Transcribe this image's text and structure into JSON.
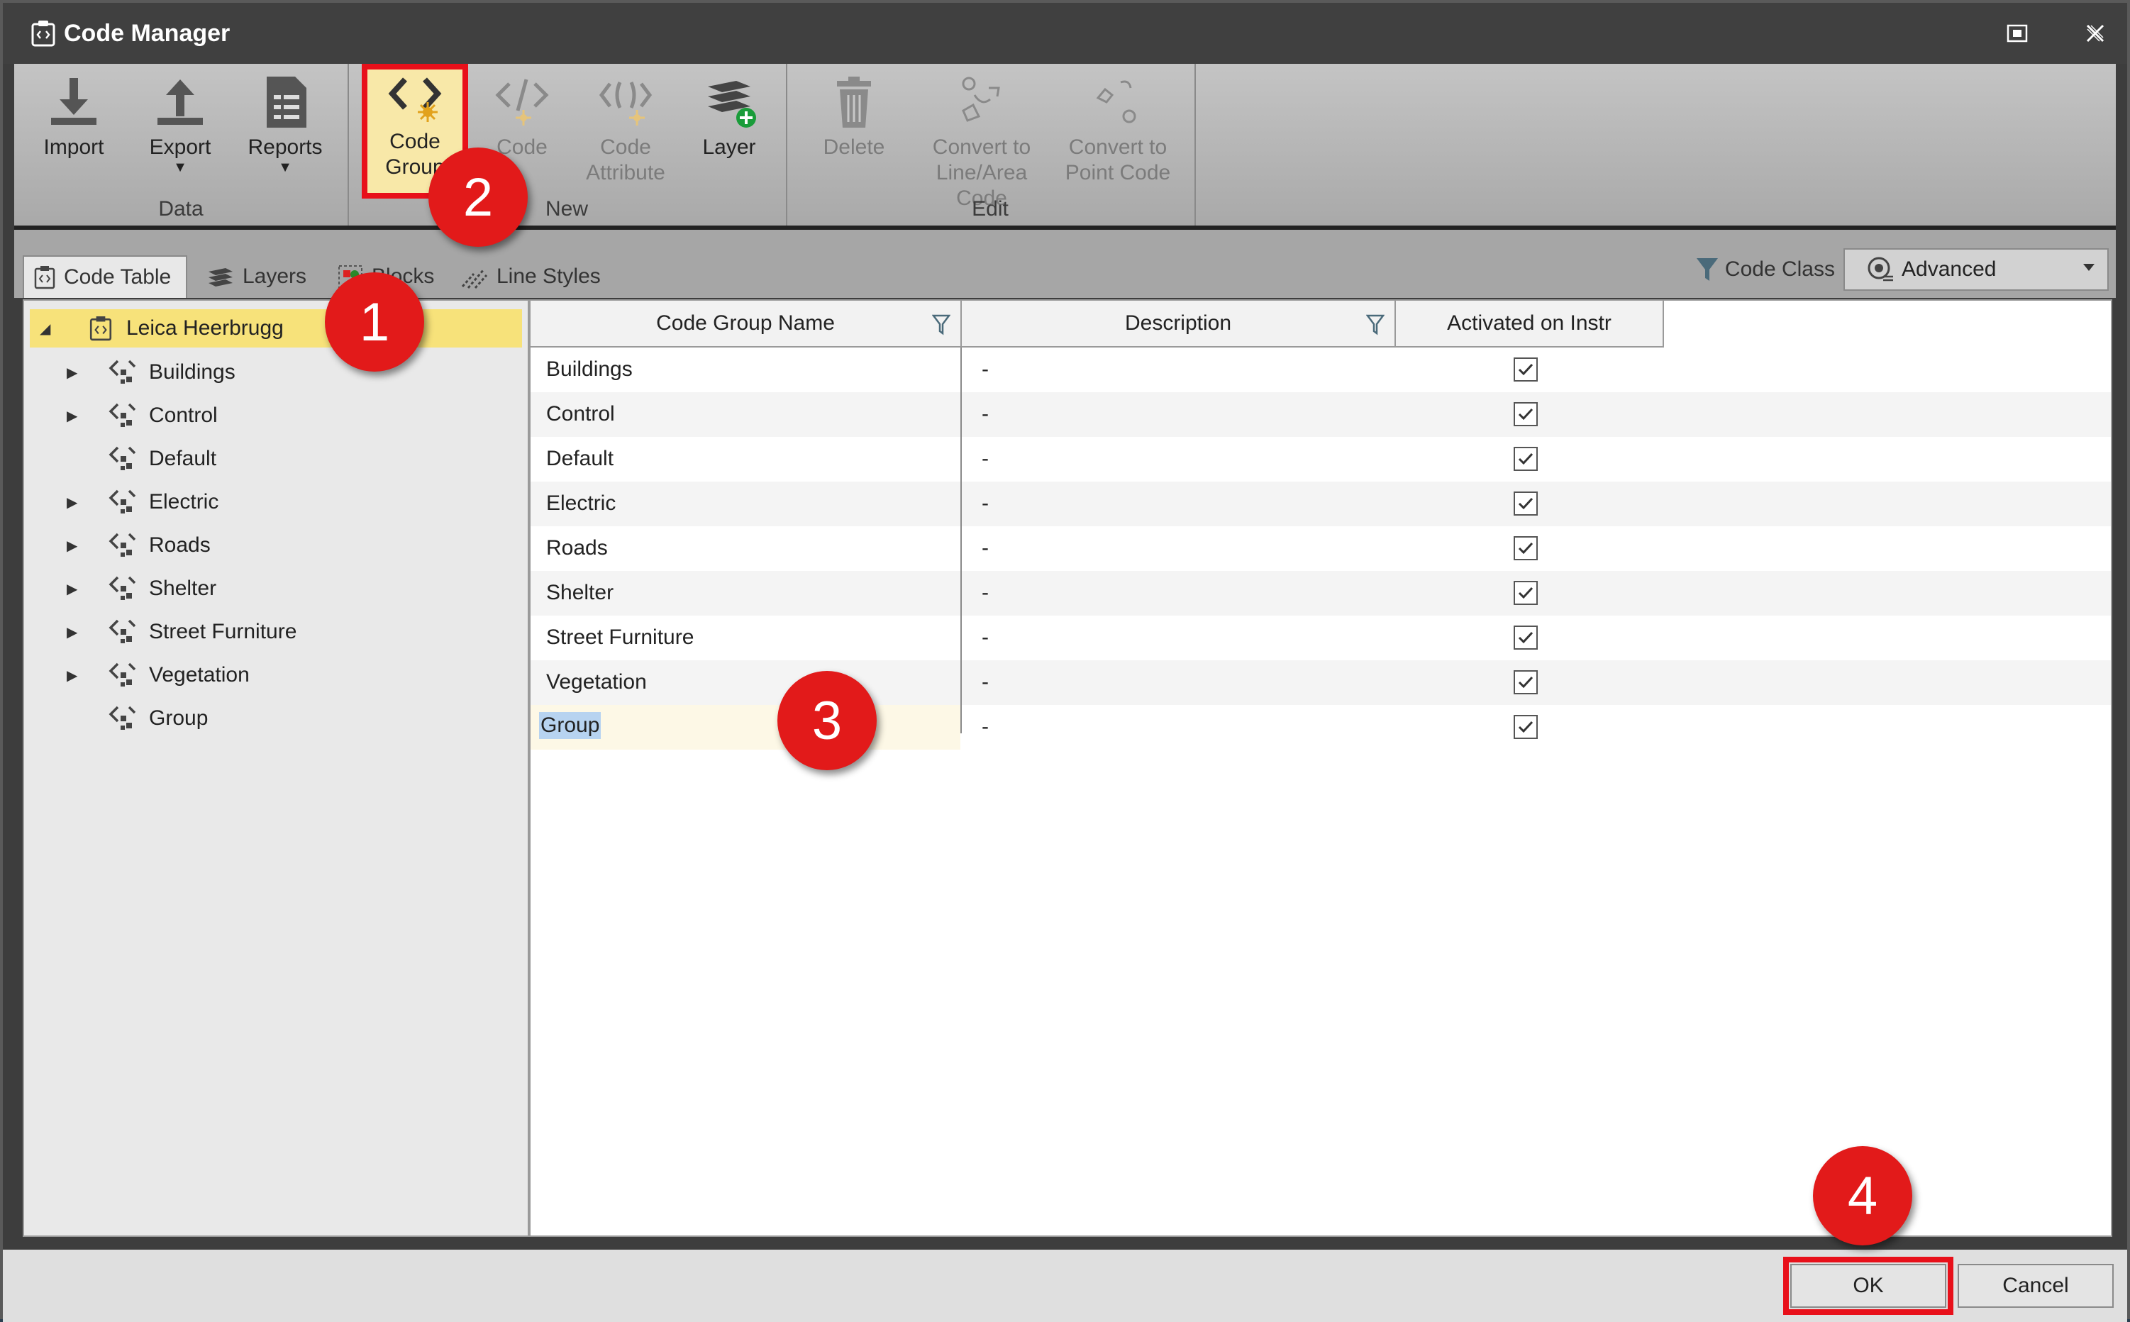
{
  "window": {
    "title": "Code Manager"
  },
  "ribbon": {
    "groups": [
      {
        "label": "Data",
        "buttons": [
          {
            "label": "Import"
          },
          {
            "label": "Export"
          },
          {
            "label": "Reports"
          }
        ]
      },
      {
        "label": "New",
        "buttons": [
          {
            "label": "Code\nGroup"
          },
          {
            "label": "Code"
          },
          {
            "label": "Code\nAttribute"
          },
          {
            "label": "Layer"
          }
        ]
      },
      {
        "label": "Edit",
        "buttons": [
          {
            "label": "Delete"
          },
          {
            "label": "Convert to\nLine/Area Code"
          },
          {
            "label": "Convert to\nPoint Code"
          }
        ]
      }
    ]
  },
  "tabs": [
    {
      "label": "Code Table"
    },
    {
      "label": "Layers"
    },
    {
      "label": "Blocks"
    },
    {
      "label": "Line Styles"
    }
  ],
  "code_class": {
    "label": "Code Class",
    "value": "Advanced"
  },
  "tree": {
    "root": "Leica Heerbrugg",
    "children": [
      {
        "label": "Buildings"
      },
      {
        "label": "Control"
      },
      {
        "label": "Default"
      },
      {
        "label": "Electric"
      },
      {
        "label": "Roads"
      },
      {
        "label": "Shelter"
      },
      {
        "label": "Street Furniture"
      },
      {
        "label": "Vegetation"
      },
      {
        "label": "Group"
      }
    ]
  },
  "grid": {
    "columns": [
      "Code Group Name",
      "Description",
      "Activated on Instr"
    ],
    "rows": [
      {
        "name": "Buildings",
        "desc": "-",
        "activated": true
      },
      {
        "name": "Control",
        "desc": "-",
        "activated": true
      },
      {
        "name": "Default",
        "desc": "-",
        "activated": true
      },
      {
        "name": "Electric",
        "desc": "-",
        "activated": true
      },
      {
        "name": "Roads",
        "desc": "-",
        "activated": true
      },
      {
        "name": "Shelter",
        "desc": "-",
        "activated": true
      },
      {
        "name": "Street Furniture",
        "desc": "-",
        "activated": true
      },
      {
        "name": "Vegetation",
        "desc": "-",
        "activated": true
      },
      {
        "name": "Group",
        "desc": "-",
        "activated": true
      }
    ]
  },
  "footer": {
    "ok": "OK",
    "cancel": "Cancel"
  },
  "callouts": [
    "1",
    "2",
    "3",
    "4"
  ],
  "colors": {
    "callout": "#e21a1a",
    "highlight_border": "#e8101a",
    "tree_selected": "#f7e27a"
  }
}
